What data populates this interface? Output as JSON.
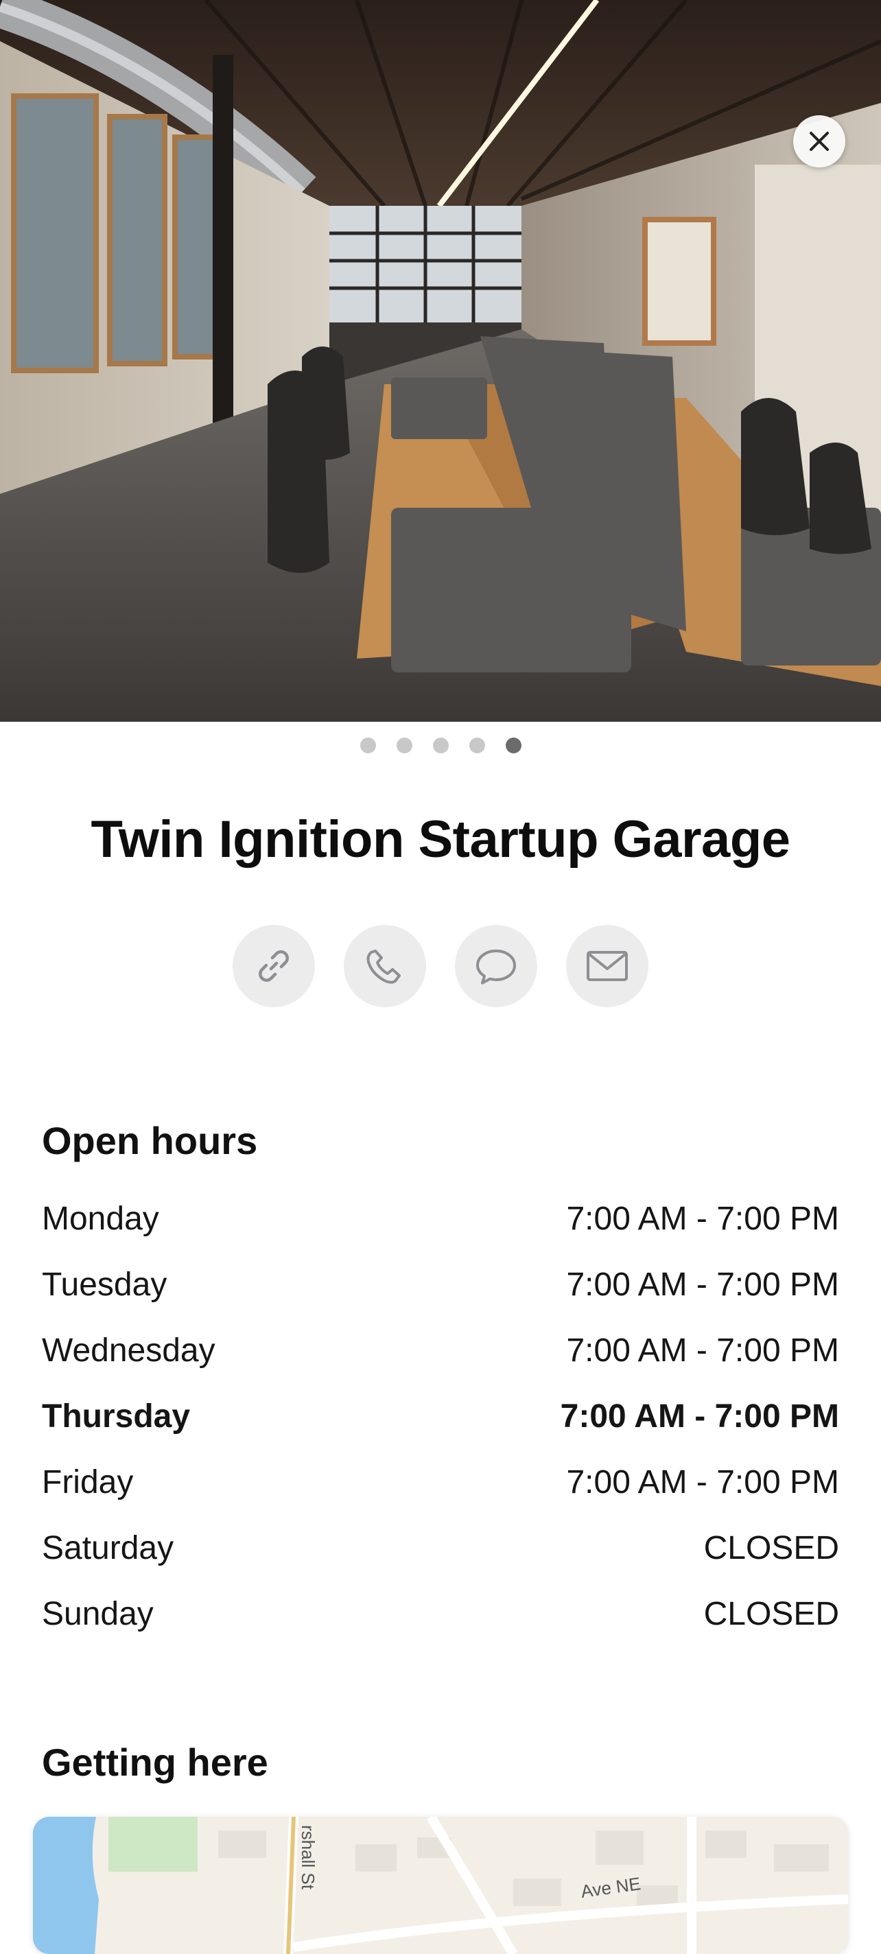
{
  "place": {
    "name": "Twin Ignition Startup Garage"
  },
  "gallery": {
    "image_count": 5,
    "active_index": 4,
    "photo_subject": "coworking-space-interior-photo"
  },
  "actions": [
    {
      "name": "website-button",
      "icon": "link-icon"
    },
    {
      "name": "call-button",
      "icon": "phone-icon"
    },
    {
      "name": "message-button",
      "icon": "message-bubble-icon"
    },
    {
      "name": "email-button",
      "icon": "envelope-icon"
    }
  ],
  "open_hours": {
    "heading": "Open hours",
    "days": [
      {
        "day": "Monday",
        "hours": "7:00 AM - 7:00 PM",
        "today": false
      },
      {
        "day": "Tuesday",
        "hours": "7:00 AM - 7:00 PM",
        "today": false
      },
      {
        "day": "Wednesday",
        "hours": "7:00 AM - 7:00 PM",
        "today": false
      },
      {
        "day": "Thursday",
        "hours": "7:00 AM - 7:00 PM",
        "today": true
      },
      {
        "day": "Friday",
        "hours": "7:00 AM - 7:00 PM",
        "today": false
      },
      {
        "day": "Saturday",
        "hours": "CLOSED",
        "today": false
      },
      {
        "day": "Sunday",
        "hours": "CLOSED",
        "today": false
      }
    ]
  },
  "getting_here": {
    "heading": "Getting here",
    "map_labels": {
      "street_1": "rshall St",
      "street_2": "Ave NE"
    }
  },
  "colors": {
    "button_bg": "#ececec",
    "icon_gray": "#8e8e93",
    "dot_active": "#6b6b6b",
    "dot_inactive": "#c8c8c8"
  }
}
